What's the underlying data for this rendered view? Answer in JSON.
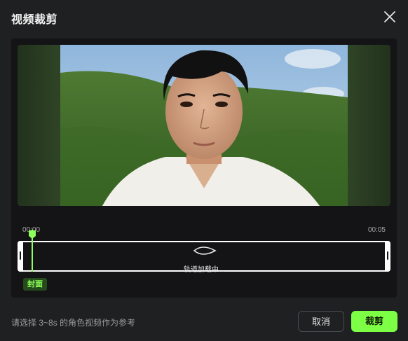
{
  "dialog": {
    "title": "视频裁剪",
    "close_icon": "close-icon"
  },
  "video": {
    "description_icon": "video-frame"
  },
  "timeline": {
    "start_time": "00:00",
    "end_time": "00:05",
    "loading_text": "轨道加载中...",
    "cover_label": "封面",
    "accent_color": "#8cff5a"
  },
  "footer": {
    "hint": "请选择 3~8s 的角色视频作为参考",
    "cancel_label": "取消",
    "crop_label": "裁剪",
    "crop_color": "#7dff45"
  }
}
